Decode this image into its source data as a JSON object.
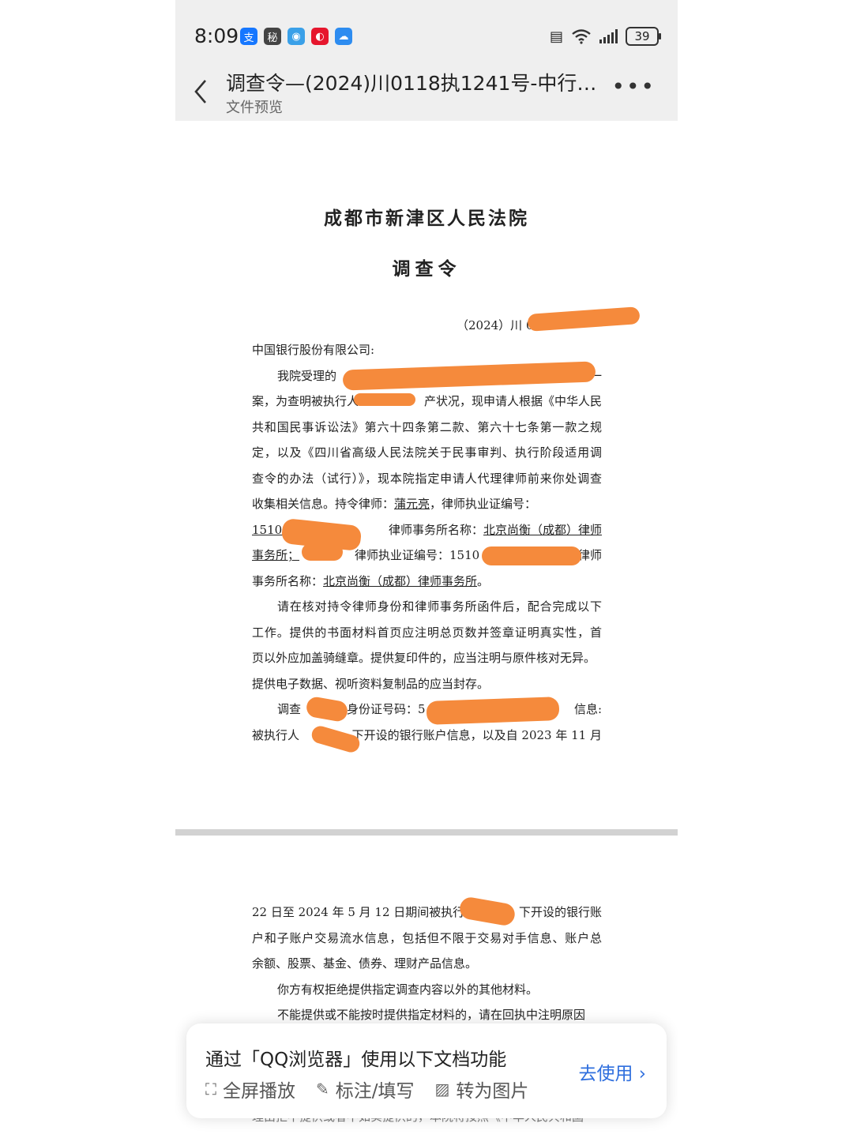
{
  "status_bar": {
    "time": "8:09",
    "battery": "39",
    "apps": [
      {
        "name": "alipay-icon",
        "glyph": "支",
        "color": "#1677ff"
      },
      {
        "name": "app-icon-2",
        "glyph": "秘",
        "color": "#444444"
      },
      {
        "name": "app-icon-3",
        "glyph": "◉",
        "color": "#3aa0e8"
      },
      {
        "name": "weibo-icon",
        "glyph": "◐",
        "color": "#e6162d"
      },
      {
        "name": "app-icon-5",
        "glyph": "☁",
        "color": "#2d8cf0"
      }
    ]
  },
  "header": {
    "title": "调查令—(2024)川0118执1241号-中行…",
    "subtitle": "文件预览"
  },
  "page1": {
    "court": "成都市新津区人民法院",
    "doc_title": "调查令",
    "case_no": "（2024）川 01",
    "lines": [
      "中国银行股份有限公司:",
      "我院受理的",
      "案，为查明被执行人",
      "共和国民事诉讼法》第六十四条第二款、第六十七条第一款之规",
      "定，以及《四川省高级人民法院关于民事审判、执行阶段适用调",
      "查令的办法（试行）》，现本院指定申请人代理律师前来你处调查",
      "收集相关信息。持令律师：蒲元亮，律师执业证编号：",
      "15101",
      "事务所；",
      "事务所名称：北京尚衡（成都）律师事务所。",
      "请在核对持令律师身份和律师事务所函件后，配合完成以下",
      "工作。提供的书面材料首页应注明总页数并签章证明真实性，首",
      "页以外应加盖骑缝章。提供复印件的，应当注明与原件核对无异。",
      "提供电子数据、视听资料复制品的应当封存。",
      "调查",
      "被执行人"
    ],
    "fragments": {
      "l2_end": "一",
      "l3_mid": "产状况，现申请人根据《中华人民",
      "l7_lawyer": "蒲元亮",
      "l7_rest": "，律师执业证编号：",
      "l7_lead": "收集相关信息。持令律师：",
      "l8_mid": "律师事务所名称：",
      "l8_firm": "北京尚衡（成都）律师",
      "l9_mid": "律师执业证编号：1510",
      "l9_end": "律师",
      "l10_lead": "事务所名称：",
      "l10_firm": "北京尚衡（成都）律师事务所",
      "l10_end": "。",
      "l15_mid": "身份证号码：5",
      "l15_end": "信息:",
      "l16_mid": "下开设的银行账户信息，以及自 2023 年 11 月"
    }
  },
  "page2": {
    "l1_lead": "22 日至 2024 年 5 月 12 日期间被执行人",
    "l1_end": "下开设的银行账",
    "l2": "户和子账户交易流水信息，包括但不限于交易对手信息、账户总",
    "l3": "余额、股票、基金、债券、理财产品信息。",
    "l4": "你方有权拒绝提供指定调查内容以外的其他材料。",
    "l5": "不能提供或不能按时提供指定材料的，请在回执中注明原因",
    "l6": "理由拒不提供或者不如实提供的，本院将按照《中华人民共和国"
  },
  "popup": {
    "title": "通过「QQ浏览器」使用以下文档功能",
    "actions": [
      {
        "label": "全屏播放",
        "icon": "fullscreen-icon",
        "glyph": "⛶"
      },
      {
        "label": "标注/填写",
        "icon": "edit-icon",
        "glyph": "✎"
      },
      {
        "label": "转为图片",
        "icon": "image-icon",
        "glyph": "▨"
      }
    ],
    "use_label": "去使用",
    "use_arrow": "›"
  },
  "colors": {
    "redaction": "#f58a3c",
    "accent": "#2f6fde"
  }
}
